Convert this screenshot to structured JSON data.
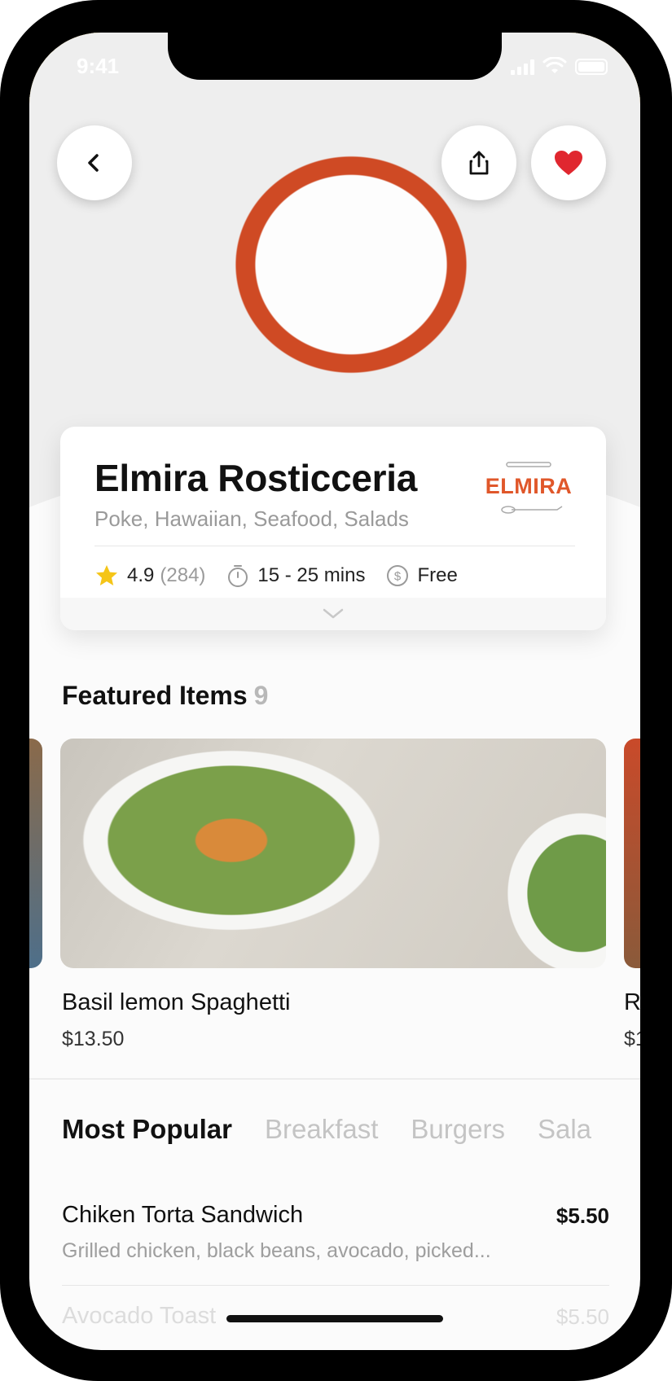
{
  "status_bar": {
    "time": "9:41"
  },
  "restaurant": {
    "name": "Elmira Rosticceria",
    "cuisines": "Poke, Hawaiian, Seafood, Salads",
    "logo_text": "ELMIRA",
    "rating": "4.9",
    "review_count": "(284)",
    "delivery_time": "15 - 25 mins",
    "delivery_fee": "Free"
  },
  "featured": {
    "title": "Featured Items",
    "count": "9",
    "items": [
      {
        "name": "Basil lemon Spaghetti",
        "price": "$13.50"
      },
      {
        "name": "R",
        "price": "$1"
      }
    ]
  },
  "tabs": [
    "Most Popular",
    "Breakfast",
    "Burgers",
    "Sala"
  ],
  "menu": [
    {
      "name": "Chiken Torta Sandwich",
      "description": "Grilled chicken, black beans, avocado, picked...",
      "price": "$5.50"
    },
    {
      "name": "Avocado Toast",
      "price": "$5.50"
    }
  ],
  "colors": {
    "accent": "#e0272f",
    "logo": "#e0572a",
    "star": "#f5c518"
  }
}
